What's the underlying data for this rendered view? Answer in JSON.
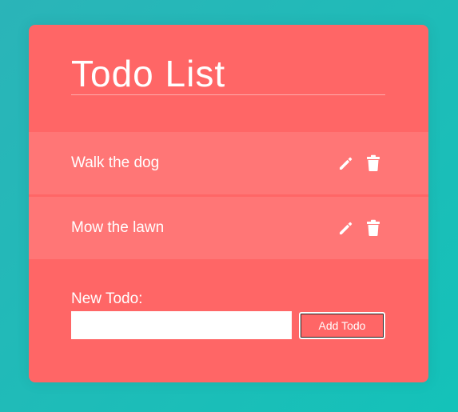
{
  "app": {
    "title": "Todo List"
  },
  "todos": [
    {
      "text": "Walk the dog",
      "edit_icon": "pencil-icon",
      "delete_icon": "trash-icon"
    },
    {
      "text": "Mow the lawn",
      "edit_icon": "pencil-icon",
      "delete_icon": "trash-icon"
    }
  ],
  "form": {
    "label": "New Todo:",
    "input_value": "",
    "input_placeholder": "",
    "button_label": "Add Todo"
  },
  "colors": {
    "background_gradient_start": "#2bb4b8",
    "background_gradient_end": "#14c2b9",
    "card": "#ff6666",
    "todo_item": "#ff7676",
    "text": "#ffffff"
  }
}
